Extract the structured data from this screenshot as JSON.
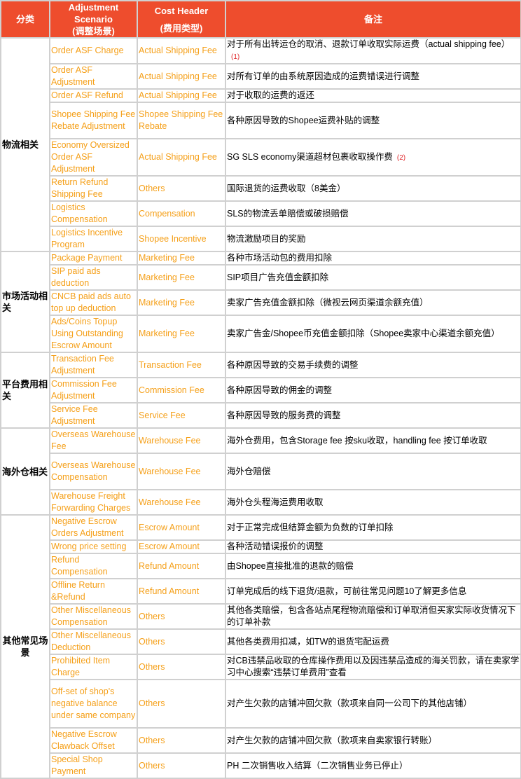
{
  "header": {
    "category": "分类",
    "scenario_line1": "Adjustment",
    "scenario_line2": "Scenario",
    "scenario_line3": "(调整场景)",
    "cost_line1": "Cost Header",
    "cost_line2": "(费用类型)",
    "note": "备注"
  },
  "colors": {
    "header_bg": "#ee4d2d",
    "header_text": "#ffffff",
    "scenario_text": "#f5a01a",
    "footnote_ref": "#e0262a",
    "border": "#d0d0d0"
  },
  "groups": [
    {
      "category": "物流相关",
      "rows": [
        {
          "scenario": "Order ASF Charge",
          "cost": "Actual Shipping Fee",
          "note": "对于所有出转运仓的取消、退款订单收取实际运费（actual shipping fee）",
          "ref": "(1)"
        },
        {
          "scenario": "Order ASF Adjustment",
          "cost": "Actual Shipping Fee",
          "note": "对所有订单的由系统原因造成的运费错误进行调整"
        },
        {
          "scenario": "Order ASF Refund",
          "cost": "Actual Shipping Fee",
          "note": "对于收取的运费的返还"
        },
        {
          "scenario": "Shopee Shipping Fee Rebate Adjustment",
          "cost": "Shopee Shipping Fee Rebate",
          "note": "各种原因导致的Shopee运费补贴的调整"
        },
        {
          "scenario": "Economy Oversized Order ASF Adjustment",
          "cost": "Actual Shipping Fee",
          "note": "SG SLS economy渠道超材包裹收取操作费",
          "ref": "(2)"
        },
        {
          "scenario": "Return Refund Shipping Fee",
          "cost": "Others",
          "note": "国际退货的运费收取（8美金）"
        },
        {
          "scenario": "Logistics Compensation",
          "cost": "Compensation",
          "note": "SLS的物流丢单赔偿或破损赔偿"
        },
        {
          "scenario": "Logistics Incentive Program",
          "cost": "Shopee Incentive",
          "note": "物流激励项目的奖励"
        }
      ]
    },
    {
      "category": "市场活动相关",
      "rows": [
        {
          "scenario": "Package Payment",
          "cost": "Marketing Fee",
          "note": "各种市场活动包的费用扣除"
        },
        {
          "scenario": "SIP paid ads deduction",
          "cost": "Marketing Fee",
          "note": "SIP项目广告充值金额扣除"
        },
        {
          "scenario": "CNCB paid ads auto top up deduction",
          "cost": "Marketing Fee",
          "note": "卖家广告充值金额扣除（微视云网页渠道余额充值）"
        },
        {
          "scenario": "Ads/Coins Topup Using Outstanding Escrow Amount",
          "cost": "Marketing Fee",
          "note": "卖家广告金/Shopee币充值金额扣除（Shopee卖家中心渠道余额充值）"
        }
      ]
    },
    {
      "category": "平台费用相关",
      "rows": [
        {
          "scenario": "Transaction Fee Adjustment",
          "cost": "Transaction Fee",
          "note": "各种原因导致的交易手续费的调整"
        },
        {
          "scenario": "Commission Fee Adjustment",
          "cost": "Commission Fee",
          "note": "各种原因导致的佣金的调整"
        },
        {
          "scenario": "Service Fee Adjustment",
          "cost": "Service Fee",
          "note": "各种原因导致的服务费的调整"
        }
      ]
    },
    {
      "category": "海外仓相关",
      "rows": [
        {
          "scenario": "Overseas Warehouse Fee",
          "cost": "Warehouse Fee",
          "note": "海外仓费用，包含Storage fee 按sku收取，handling fee 按订单收取"
        },
        {
          "scenario": "Overseas Warehouse Compensation",
          "cost": "Warehouse Fee",
          "note": "海外仓赔偿"
        },
        {
          "scenario": "Warehouse Freight Forwarding Charges",
          "cost": "Warehouse Fee",
          "note": "海外仓头程海运费用收取"
        }
      ]
    },
    {
      "category": "其他常见场景",
      "rows": [
        {
          "scenario": "Negative Escrow Orders Adjustment",
          "cost": "Escrow Amount",
          "note": "对于正常完成但结算金额为负数的订单扣除"
        },
        {
          "scenario": "Wrong price setting",
          "cost": "Escrow Amount",
          "note": "各种活动错误报价的调整"
        },
        {
          "scenario": "Refund Compensation",
          "cost": "Refund Amount",
          "note": "由Shopee直接批准的退款的赔偿"
        },
        {
          "scenario": "Offline Return &Refund",
          "cost": "Refund Amount",
          "note": "订单完成后的线下退货/退款，可前往常见问题10了解更多信息"
        },
        {
          "scenario": "Other Miscellaneous Compensation",
          "cost": "Others",
          "note": "其他各类赔偿，包含各站点尾程物流赔偿和订单取消但买家实际收货情况下的订单补款"
        },
        {
          "scenario": "Other Miscellaneous Deduction",
          "cost": "Others",
          "note": "其他各类费用扣减，如TW的退货宅配运费"
        },
        {
          "scenario": "Prohibited Item Charge",
          "cost": "Others",
          "note": "对CB违禁品收取的仓库操作费用以及因违禁品造成的海关罚款，请在卖家学习中心搜索“违禁订单费用”查看"
        },
        {
          "scenario": "Off-set of shop's negative balance under same company",
          "cost": "Others",
          "note": "对产生欠款的店铺冲回欠款（款项来自同一公司下的其他店铺）"
        },
        {
          "scenario": "Negative Escrow Clawback Offset",
          "cost": "Others",
          "note": "对产生欠款的店铺冲回欠款（款项来自卖家银行转账）"
        },
        {
          "scenario": "Special Shop Payment",
          "cost": "Others",
          "note": "PH 二次销售收入结算（二次销售业务已停止）"
        }
      ]
    }
  ]
}
